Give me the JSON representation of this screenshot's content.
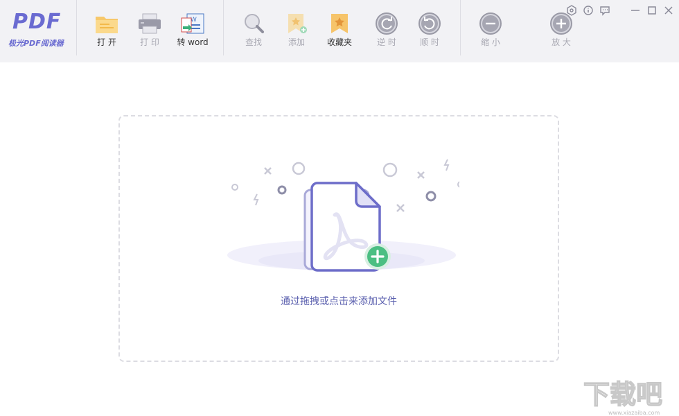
{
  "app": {
    "logo_mark": "PDF",
    "logo_name": "极光PDF阅读器"
  },
  "toolbar": {
    "open": "打 开",
    "print": "打 印",
    "to_word": "转 word",
    "find": "查找",
    "add": "添加",
    "favorites": "收藏夹",
    "rotate_ccw": "逆 时",
    "rotate_cw": "顺 时",
    "zoom_out": "缩 小",
    "zoom_in": "放 大"
  },
  "icons": {
    "open": "folder-icon",
    "print": "printer-icon",
    "to_word": "word-convert-icon",
    "find": "magnifier-icon",
    "add": "add-bookmark-icon",
    "favorites": "bookmark-star-icon",
    "rotate_ccw": "rotate-ccw-icon",
    "rotate_cw": "rotate-cw-icon",
    "zoom_out": "minus-circle-icon",
    "zoom_in": "plus-circle-icon",
    "settings": "settings-icon",
    "info": "info-icon",
    "feedback": "feedback-icon",
    "minimize": "minimize-icon",
    "maximize": "maximize-icon",
    "close": "close-icon"
  },
  "colors": {
    "accent": "#6a6bd1",
    "toolbar_bg": "#f2f2f5",
    "hint_text": "#5a5fae",
    "add_badge": "#4bbf82"
  },
  "drop_zone": {
    "hint": "通过拖拽或点击来添加文件"
  },
  "watermark": {
    "text": "下载吧",
    "url": "www.xiazaiba.com"
  }
}
